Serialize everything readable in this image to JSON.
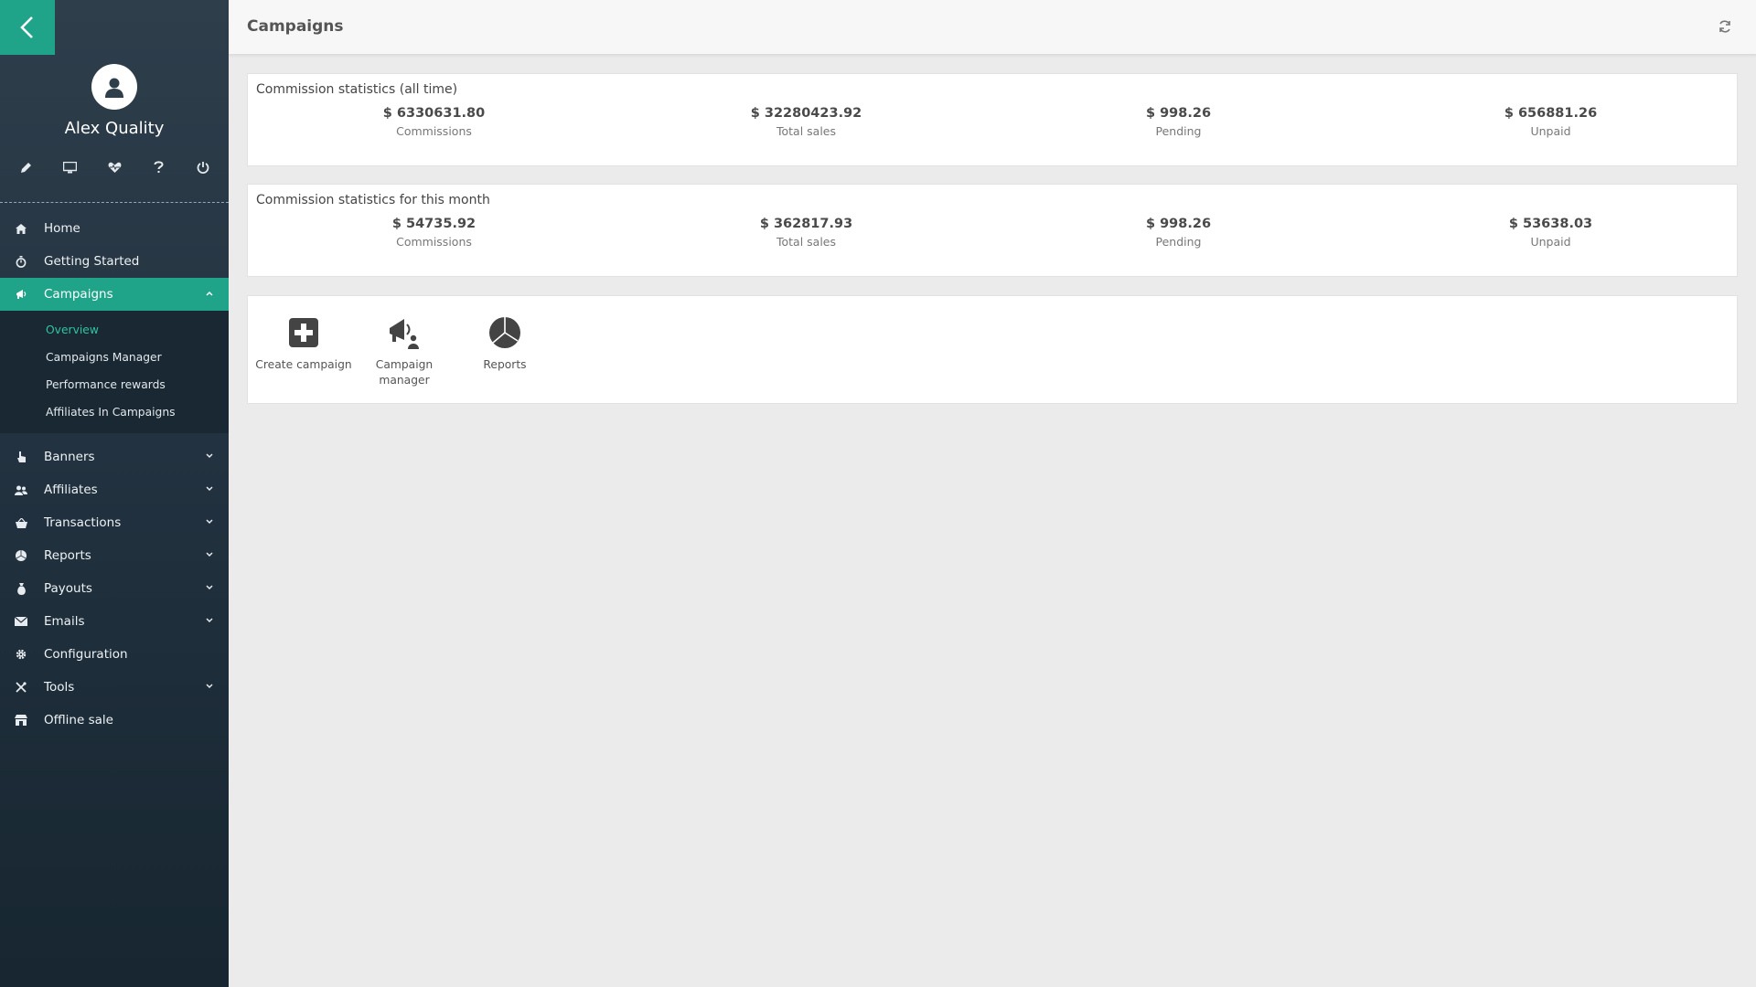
{
  "app": {
    "accent_color": "#1fa48a",
    "sidebar_color": "#223240"
  },
  "user": {
    "name": "Alex Quality"
  },
  "quick_icons": [
    "pencil-icon",
    "monitor-icon",
    "heartbeat-icon",
    "question-icon",
    "power-icon"
  ],
  "menu": {
    "items": [
      {
        "label": "Home",
        "icon": "home-icon"
      },
      {
        "label": "Getting Started",
        "icon": "stopwatch-icon"
      },
      {
        "label": "Campaigns",
        "icon": "megaphone-icon",
        "active": true,
        "expanded": true
      }
    ],
    "submenu": [
      {
        "label": "Overview",
        "active": true
      },
      {
        "label": "Campaigns Manager"
      },
      {
        "label": "Performance rewards"
      },
      {
        "label": "Affiliates In Campaigns"
      }
    ],
    "more_items": [
      {
        "label": "Banners",
        "icon": "hand-pointer-icon"
      },
      {
        "label": "Affiliates",
        "icon": "users-icon"
      },
      {
        "label": "Transactions",
        "icon": "basket-icon"
      },
      {
        "label": "Reports",
        "icon": "pie-chart-icon"
      },
      {
        "label": "Payouts",
        "icon": "money-bag-icon"
      },
      {
        "label": "Emails",
        "icon": "envelope-icon"
      },
      {
        "label": "Configuration",
        "icon": "gear-icon"
      },
      {
        "label": "Tools",
        "icon": "tools-icon"
      },
      {
        "label": "Offline sale",
        "icon": "shop-icon"
      }
    ]
  },
  "header": {
    "title": "Campaigns"
  },
  "stats_all_time": {
    "title": "Commission statistics (all time)",
    "items": [
      {
        "value": "$ 6330631.80",
        "label": "Commissions"
      },
      {
        "value": "$ 32280423.92",
        "label": "Total sales"
      },
      {
        "value": "$ 998.26",
        "label": "Pending"
      },
      {
        "value": "$ 656881.26",
        "label": "Unpaid"
      }
    ]
  },
  "stats_month": {
    "title": "Commission statistics for this month",
    "items": [
      {
        "value": "$ 54735.92",
        "label": "Commissions"
      },
      {
        "value": "$ 362817.93",
        "label": "Total sales"
      },
      {
        "value": "$ 998.26",
        "label": "Pending"
      },
      {
        "value": "$ 53638.03",
        "label": "Unpaid"
      }
    ]
  },
  "actions": [
    {
      "label": "Create campaign",
      "icon": "plus-square-icon"
    },
    {
      "label": "Campaign manager",
      "icon": "megaphone-person-icon"
    },
    {
      "label": "Reports",
      "icon": "pie-chart-icon"
    }
  ]
}
